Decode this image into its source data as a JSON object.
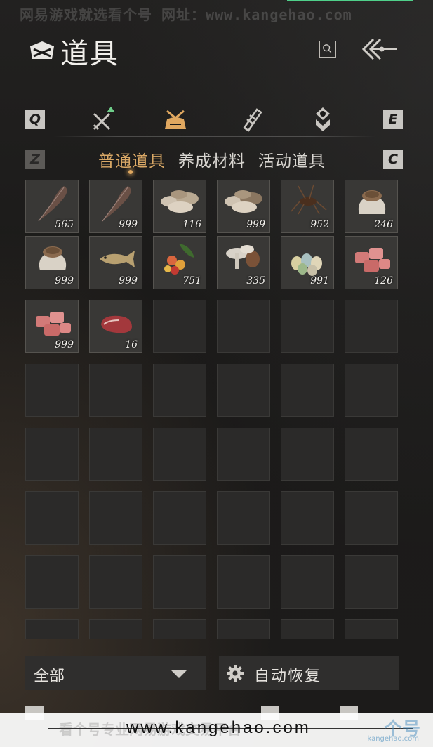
{
  "watermark_top": "网易游戏就选看个号   网址：www.kangehao.com",
  "header": {
    "title": "道具"
  },
  "keys": {
    "prev_category": "Q",
    "next_category": "E",
    "prev_subtab": "Z",
    "next_subtab": "C"
  },
  "categories": [
    {
      "icon": "sword-upgrade-icon",
      "active": false
    },
    {
      "icon": "item-bag-icon",
      "active": true
    },
    {
      "icon": "scroll-icon",
      "active": false
    },
    {
      "icon": "badge-icon",
      "active": false
    }
  ],
  "subtabs": [
    {
      "label": "普通道具",
      "active": true
    },
    {
      "label": "养成材料",
      "active": false
    },
    {
      "label": "活动道具",
      "active": false
    }
  ],
  "items": [
    {
      "icon": "feather-icon",
      "count": "565"
    },
    {
      "icon": "feather-icon",
      "count": "999"
    },
    {
      "icon": "mushroom-pile-icon",
      "count": "116"
    },
    {
      "icon": "mushroom-pile-icon",
      "count": "999"
    },
    {
      "icon": "cricket-icon",
      "count": "952"
    },
    {
      "icon": "grain-sack-icon",
      "count": "246"
    },
    {
      "icon": "grain-sack-icon",
      "count": "999"
    },
    {
      "icon": "fish-icon",
      "count": "999"
    },
    {
      "icon": "berries-icon",
      "count": "751"
    },
    {
      "icon": "mushrooms-icon",
      "count": "335"
    },
    {
      "icon": "eggs-icon",
      "count": "991"
    },
    {
      "icon": "meat-chunks-icon",
      "count": "126"
    },
    {
      "icon": "meat-chunks-icon",
      "count": "999"
    },
    {
      "icon": "steak-icon",
      "count": "16"
    }
  ],
  "footer": {
    "filter_label": "全部",
    "auto_restore_label": "自动恢复"
  },
  "watermark_bottom": {
    "url": "www.kangehao.com",
    "faded_text": "看个号专业网易游戏交易平台",
    "logo": "个号",
    "logo_sub": "kangehao.com"
  },
  "colors": {
    "accent": "#d9a866",
    "background": "#1a1918",
    "cell": "#393836"
  }
}
